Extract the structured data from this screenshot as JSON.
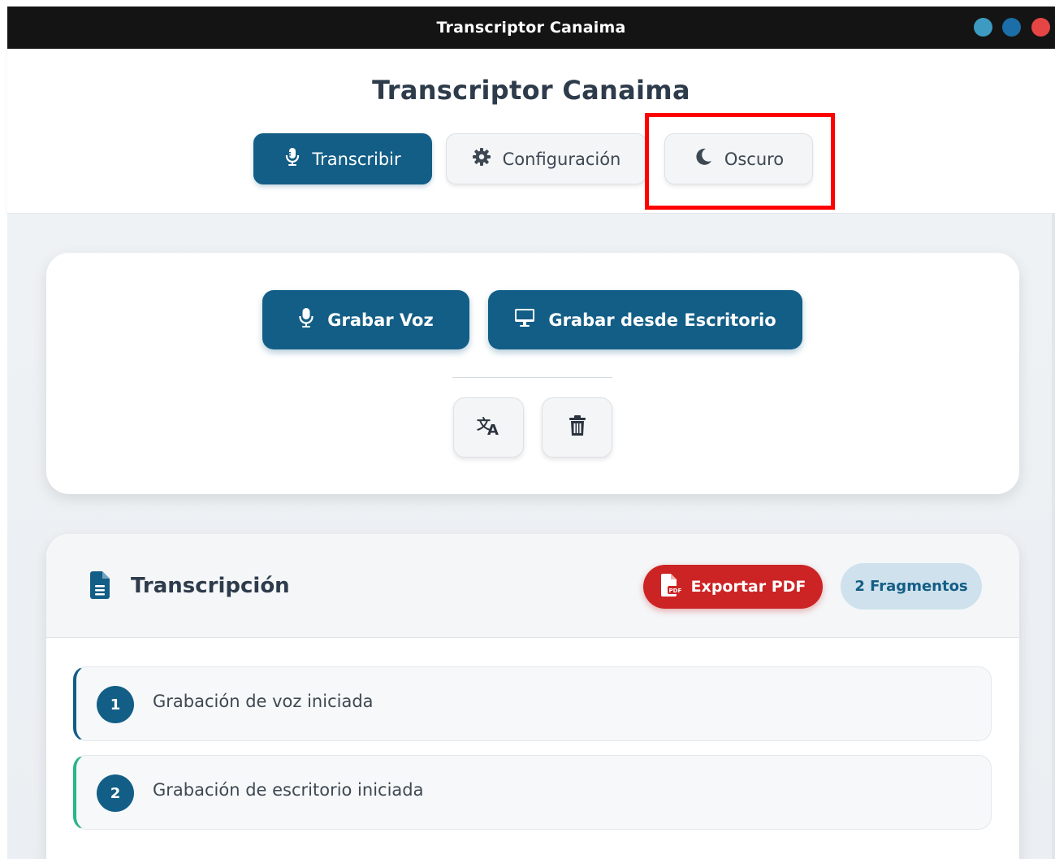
{
  "window": {
    "title": "Transcriptor Canaima",
    "controls": [
      "minimize",
      "maximize",
      "close"
    ],
    "control_colors": {
      "minimize": "#3d9bc1",
      "maximize": "#1b6ea8",
      "close": "#e64545"
    }
  },
  "header": {
    "app_title": "Transcriptor Canaima",
    "nav": [
      {
        "label": "Transcribir",
        "icon": "microphone-icon",
        "active": true
      },
      {
        "label": "Configuración",
        "icon": "gear-icon",
        "active": false
      },
      {
        "label": "Oscuro",
        "icon": "moon-icon",
        "active": false,
        "highlighted": true
      }
    ]
  },
  "record_panel": {
    "voice_button": "Grabar Voz",
    "desktop_button": "Grabar desde Escritorio",
    "translate_icon": "translate-icon",
    "trash_icon": "trash-icon"
  },
  "transcription": {
    "title": "Transcripción",
    "export_button": "Exportar PDF",
    "fragment_count": "2 Fragmentos",
    "fragments": [
      {
        "number": "1",
        "text": "Grabación de voz iniciada",
        "accent": "#135e86"
      },
      {
        "number": "2",
        "text": "Grabación de escritorio iniciada",
        "accent": "#2bb58a"
      }
    ]
  },
  "colors": {
    "primary": "#135e86",
    "danger": "#cc2424",
    "badge_bg": "#cfe1ec",
    "highlight": "#ff0000"
  }
}
